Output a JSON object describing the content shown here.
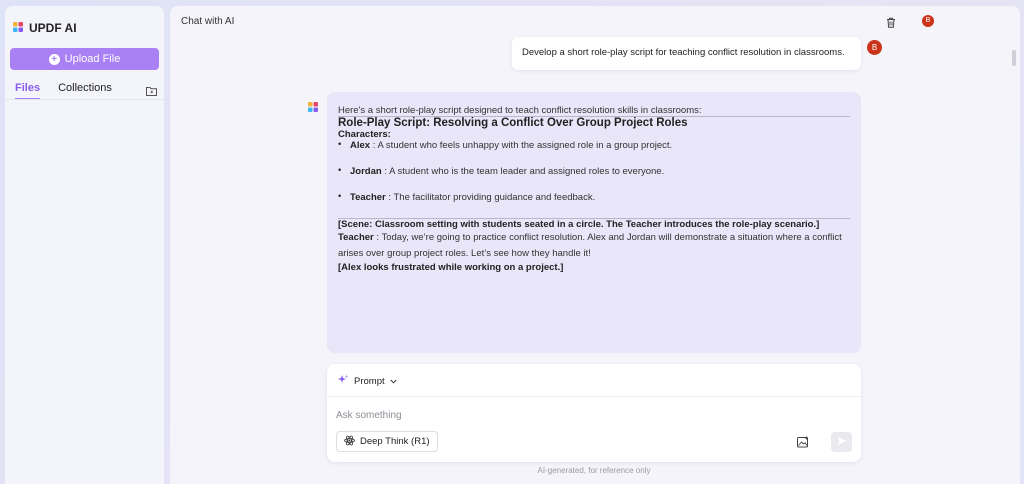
{
  "sidebar": {
    "brand": "UPDF AI",
    "upload_label": "Upload File",
    "tabs": [
      {
        "label": "Files",
        "active": true
      },
      {
        "label": "Collections",
        "active": false
      }
    ]
  },
  "header": {
    "title": "Chat with AI",
    "avatar_letter": "B"
  },
  "chat": {
    "user_message": "Develop a short role-play script for teaching conflict resolution in classrooms.",
    "user_avatar": "B",
    "ai": {
      "intro": "Here's a short role-play script designed to teach conflict resolution skills in classrooms:",
      "heading": "Role-Play Script: Resolving a Conflict Over Group Project Roles",
      "characters_label": "Characters:",
      "characters": [
        {
          "name": "Alex",
          "desc": " : A student who feels unhappy with the assigned role in a group project."
        },
        {
          "name": "Jordan",
          "desc": " : A student who is the team leader and assigned roles to everyone."
        },
        {
          "name": "Teacher",
          "desc": " : The facilitator providing guidance and feedback."
        }
      ],
      "scene": "[Scene: Classroom setting with students seated in a circle. The Teacher introduces the role-play scenario.]",
      "teacher_name": "Teacher",
      "teacher_line": " : Today, we’re going to practice conflict resolution. Alex and Jordan will demonstrate a situation where a conflict arises over group project roles. Let’s see how they handle it!",
      "stage_direction": "[Alex looks frustrated while working on a project.]"
    }
  },
  "composer": {
    "prompt_label": "Prompt",
    "placeholder": "Ask something",
    "deep_think_label": "Deep Think (R1)",
    "footer": "AI-generated, for reference only"
  },
  "colors": {
    "accent": "#a981f5",
    "avatar": "#c9341a",
    "ai_bubble": "#e8e6f8"
  }
}
